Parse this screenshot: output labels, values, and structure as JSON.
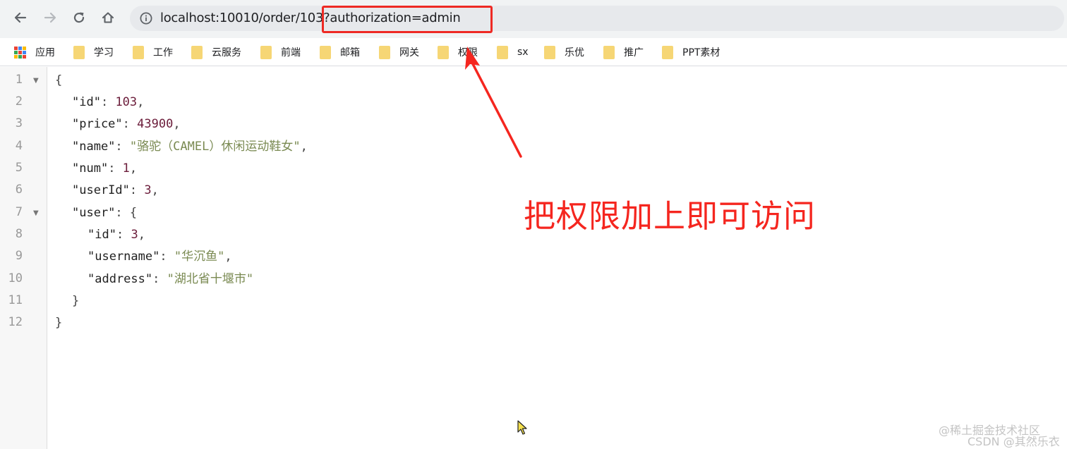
{
  "toolbar": {
    "url_base": "localhost:10010/order/103",
    "url_query": "?authorization=admin",
    "icons": {
      "back": "back-arrow-icon",
      "forward": "forward-arrow-icon",
      "reload": "reload-icon",
      "home": "home-icon",
      "site_info": "info-icon"
    }
  },
  "bookmarks": {
    "apps_label": "应用",
    "items": [
      {
        "label": "学习"
      },
      {
        "label": "工作"
      },
      {
        "label": "云服务"
      },
      {
        "label": "前端"
      },
      {
        "label": "邮箱"
      },
      {
        "label": "网关"
      },
      {
        "label": "权限"
      },
      {
        "label": "sx"
      },
      {
        "label": "乐优"
      },
      {
        "label": "推广"
      },
      {
        "label": "PPT素材"
      }
    ]
  },
  "json_view": {
    "line_numbers": [
      "1",
      "2",
      "3",
      "4",
      "5",
      "6",
      "7",
      "8",
      "9",
      "10",
      "11",
      "12"
    ],
    "open_brace": "{",
    "close_brace": "}",
    "user_open": "{",
    "user_close": "}",
    "fields": {
      "id_key": "\"id\"",
      "id_value": "103",
      "price_key": "\"price\"",
      "price_value": "43900",
      "name_key": "\"name\"",
      "name_value": "\"骆驼（CAMEL）休闲运动鞋女\"",
      "num_key": "\"num\"",
      "num_value": "1",
      "userId_key": "\"userId\"",
      "userId_value": "3",
      "user_key": "\"user\"",
      "user_id_key": "\"id\"",
      "user_id_value": "3",
      "username_key": "\"username\"",
      "username_value": "\"华沉鱼\"",
      "address_key": "\"address\"",
      "address_value": "\"湖北省十堰市\""
    }
  },
  "annotation": {
    "text": "把权限加上即可访问",
    "color": "#f5261f"
  },
  "watermarks": {
    "line1": "@稀土掘金技术社区",
    "line2": "CSDN @其然乐衣"
  },
  "colors": {
    "highlight": "#ee2a24",
    "folder": "#f6d675",
    "number": "#6b1c3a",
    "string": "#7a8a52"
  }
}
